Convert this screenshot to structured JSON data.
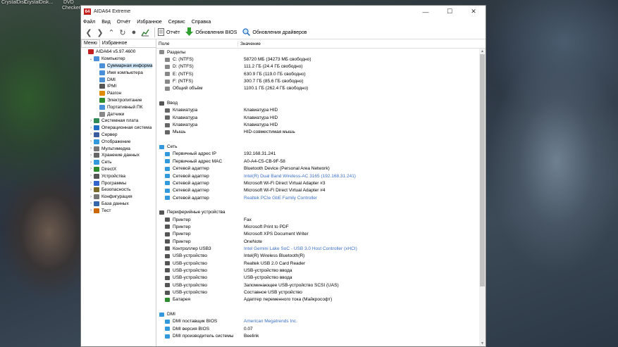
{
  "desktop": {
    "labels": [
      "CrystalDisk...",
      "CrystalDisk...",
      "DVD",
      "",
      "Checker"
    ]
  },
  "window": {
    "title": "AIDA64 Extreme",
    "icon_text": "64"
  },
  "menu": [
    "Файл",
    "Вид",
    "Отчёт",
    "Избранное",
    "Сервис",
    "Справка"
  ],
  "toolbar": {
    "report": "Отчёт",
    "bios_update": "Обновления BIOS",
    "driver_update": "Обновления драйверов"
  },
  "left_tabs": [
    "Меню",
    "Избранное"
  ],
  "tree": [
    {
      "level": 0,
      "exp": "",
      "label": "AIDA64 v5.97.4600",
      "color": "#c41f1f"
    },
    {
      "level": 1,
      "exp": "⌄",
      "label": "Компьютер",
      "color": "#4a90d9"
    },
    {
      "level": 2,
      "exp": "",
      "label": "Суммарная информа",
      "color": "#4a90d9",
      "sel": true
    },
    {
      "level": 2,
      "exp": "",
      "label": "Имя компьютера",
      "color": "#4a90d9"
    },
    {
      "level": 2,
      "exp": "",
      "label": "DMI",
      "color": "#4a90d9"
    },
    {
      "level": 2,
      "exp": "",
      "label": "IPMI",
      "color": "#555"
    },
    {
      "level": 2,
      "exp": "",
      "label": "Разгон",
      "color": "#e08a00"
    },
    {
      "level": 2,
      "exp": "",
      "label": "Электропитание",
      "color": "#2e8b2e"
    },
    {
      "level": 2,
      "exp": "",
      "label": "Портативный ПК",
      "color": "#4a90d9"
    },
    {
      "level": 2,
      "exp": "",
      "label": "Датчики",
      "color": "#888"
    },
    {
      "level": 1,
      "exp": "›",
      "label": "Системная плата",
      "color": "#2e8b57"
    },
    {
      "level": 1,
      "exp": "›",
      "label": "Операционная система",
      "color": "#1e6fc4"
    },
    {
      "level": 1,
      "exp": "›",
      "label": "Сервер",
      "color": "#3b5ba0"
    },
    {
      "level": 1,
      "exp": "›",
      "label": "Отображение",
      "color": "#3399dd"
    },
    {
      "level": 1,
      "exp": "›",
      "label": "Мультимедиа",
      "color": "#777"
    },
    {
      "level": 1,
      "exp": "›",
      "label": "Хранение данных",
      "color": "#666"
    },
    {
      "level": 1,
      "exp": "›",
      "label": "Сеть",
      "color": "#3399dd"
    },
    {
      "level": 1,
      "exp": "›",
      "label": "DirectX",
      "color": "#2e8b2e"
    },
    {
      "level": 1,
      "exp": "›",
      "label": "Устройства",
      "color": "#555"
    },
    {
      "level": 1,
      "exp": "›",
      "label": "Программы",
      "color": "#3366cc"
    },
    {
      "level": 1,
      "exp": "›",
      "label": "Безопасность",
      "color": "#7a6a2a"
    },
    {
      "level": 1,
      "exp": "›",
      "label": "Конфигурация",
      "color": "#777"
    },
    {
      "level": 1,
      "exp": "›",
      "label": "База данных",
      "color": "#3366aa"
    },
    {
      "level": 1,
      "exp": "›",
      "label": "Тест",
      "color": "#cc6600"
    }
  ],
  "columns": {
    "field": "Поле",
    "value": "Значение"
  },
  "rows": [
    {
      "type": "sec",
      "field": "Разделы",
      "color": "#888"
    },
    {
      "field": "C: (NTFS)",
      "value": "58720 МБ (34273 МБ свободно)",
      "color": "#888"
    },
    {
      "field": "D: (NTFS)",
      "value": "111.2 ГБ (24.4 ГБ свободно)",
      "color": "#888"
    },
    {
      "field": "E: (NTFS)",
      "value": "630.9 ГБ (119.0 ГБ свободно)",
      "color": "#888"
    },
    {
      "field": "F: (NTFS)",
      "value": "300.7 ГБ (85.6 ГБ свободно)",
      "color": "#888"
    },
    {
      "field": "Общий объём",
      "value": "1100.1 ГБ (262.4 ГБ свободно)",
      "color": "#888"
    },
    {
      "type": "blank"
    },
    {
      "type": "sec",
      "field": "Ввод",
      "color": "#555"
    },
    {
      "field": "Клавиатура",
      "value": "Клавиатура HID",
      "color": "#666"
    },
    {
      "field": "Клавиатура",
      "value": "Клавиатура HID",
      "color": "#666"
    },
    {
      "field": "Клавиатура",
      "value": "Клавиатура HID",
      "color": "#666"
    },
    {
      "field": "Мышь",
      "value": "HID-совместимая мышь",
      "color": "#666"
    },
    {
      "type": "blank"
    },
    {
      "type": "sec",
      "field": "Сеть",
      "color": "#3399dd"
    },
    {
      "field": "Первичный адрес IP",
      "value": "192.168.31.241",
      "color": "#3399dd"
    },
    {
      "field": "Первичный адрес MAC",
      "value": "A0-A4-C5-CB-9F-58",
      "color": "#3399dd"
    },
    {
      "field": "Сетевой адаптер",
      "value": "Bluetooth Device (Personal Area Network)",
      "color": "#3399dd"
    },
    {
      "field": "Сетевой адаптер",
      "value": "Intel(R) Dual Band Wireless-AC 3165  (192.168.31.241)",
      "color": "#3399dd",
      "link": true
    },
    {
      "field": "Сетевой адаптер",
      "value": "Microsoft Wi-Fi Direct Virtual Adapter #3",
      "color": "#3399dd"
    },
    {
      "field": "Сетевой адаптер",
      "value": "Microsoft Wi-Fi Direct Virtual Adapter #4",
      "color": "#3399dd"
    },
    {
      "field": "Сетевой адаптер",
      "value": "Realtek PCIe GbE Family Controller",
      "color": "#3399dd",
      "link": true
    },
    {
      "type": "blank"
    },
    {
      "type": "sec",
      "field": "Периферийные устройства",
      "color": "#555"
    },
    {
      "field": "Принтер",
      "value": "Fax",
      "color": "#555"
    },
    {
      "field": "Принтер",
      "value": "Microsoft Print to PDF",
      "color": "#555"
    },
    {
      "field": "Принтер",
      "value": "Microsoft XPS Document Writer",
      "color": "#555"
    },
    {
      "field": "Принтер",
      "value": "OneNote",
      "color": "#555"
    },
    {
      "field": "Контроллер USB3",
      "value": "Intel Gemini Lake SoC - USB 3.0 Host Controller (xHCI)",
      "color": "#555",
      "link": true
    },
    {
      "field": "USB-устройство",
      "value": "Intel(R) Wireless Bluetooth(R)",
      "color": "#555"
    },
    {
      "field": "USB-устройство",
      "value": "Realtek USB 2.0 Card Reader",
      "color": "#555"
    },
    {
      "field": "USB-устройство",
      "value": "USB-устройство ввода",
      "color": "#555"
    },
    {
      "field": "USB-устройство",
      "value": "USB-устройство ввода",
      "color": "#555"
    },
    {
      "field": "USB-устройство",
      "value": "Запоминающее USB-устройство SCSI (UAS)",
      "color": "#555"
    },
    {
      "field": "USB-устройство",
      "value": "Составное USB устройство",
      "color": "#555"
    },
    {
      "field": "Батарея",
      "value": "Адаптер переменного тока (Майкрософт)",
      "color": "#2e8b2e"
    },
    {
      "type": "blank"
    },
    {
      "type": "sec",
      "field": "DMI",
      "color": "#3399dd"
    },
    {
      "field": "DMI поставщик BIOS",
      "value": "American Megatrends Inc.",
      "color": "#3399dd",
      "link": true
    },
    {
      "field": "DMI версия BIOS",
      "value": "0.07",
      "color": "#3399dd"
    },
    {
      "field": "DMI производитель системы",
      "value": "Beelink",
      "color": "#3399dd"
    }
  ]
}
